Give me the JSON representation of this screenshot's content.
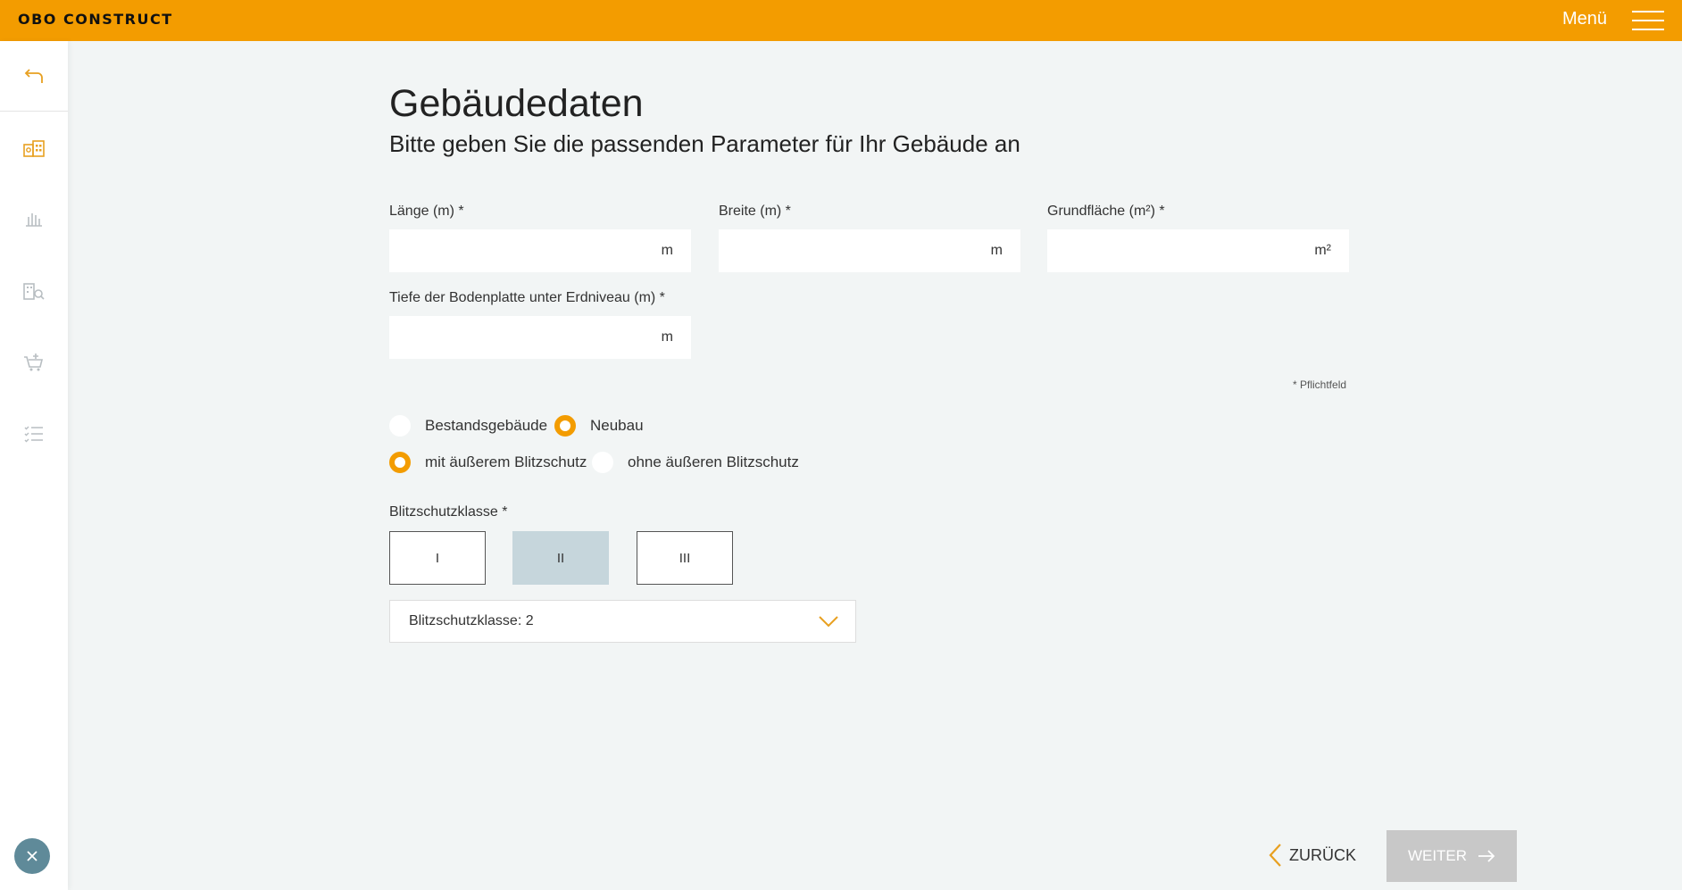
{
  "header": {
    "logo": "OBO CONSTRUCT",
    "menu_label": "Menü",
    "accent": "#f39c00"
  },
  "sidebar": {
    "icons": [
      "back-arrow-icon",
      "building-data-icon",
      "grounding-icon",
      "building-search-icon",
      "cart-add-icon",
      "checklist-icon"
    ],
    "close_icon": "close-icon"
  },
  "page": {
    "title": "Gebäudedaten",
    "subtitle": "Bitte geben Sie die passenden Parameter für Ihr Gebäude an"
  },
  "fields": {
    "laenge": {
      "label": "Länge (m) *",
      "value": "",
      "unit": "m"
    },
    "breite": {
      "label": "Breite (m) *",
      "value": "",
      "unit": "m"
    },
    "grundflaeche": {
      "label": "Grundfläche (m²) *",
      "value": "",
      "unit": "m²"
    },
    "tiefe": {
      "label": "Tiefe der Bodenplatte unter Erdniveau (m) *",
      "value": "",
      "unit": "m"
    }
  },
  "required_note": "* Pflichtfeld",
  "building_type": {
    "options": [
      "Bestandsgebäude",
      "Neubau"
    ],
    "selected": "Neubau"
  },
  "lightning": {
    "options": [
      "mit äußerem Blitzschutz",
      "ohne äußeren Blitzschutz"
    ],
    "selected": "mit äußerem Blitzschutz"
  },
  "protection_class": {
    "label": "Blitzschutzklasse *",
    "options": [
      "I",
      "II",
      "III"
    ],
    "selected": "II",
    "dropdown_value": "Blitzschutzklasse: 2"
  },
  "nav": {
    "back_label": "ZURÜCK",
    "next_label": "WEITER"
  }
}
